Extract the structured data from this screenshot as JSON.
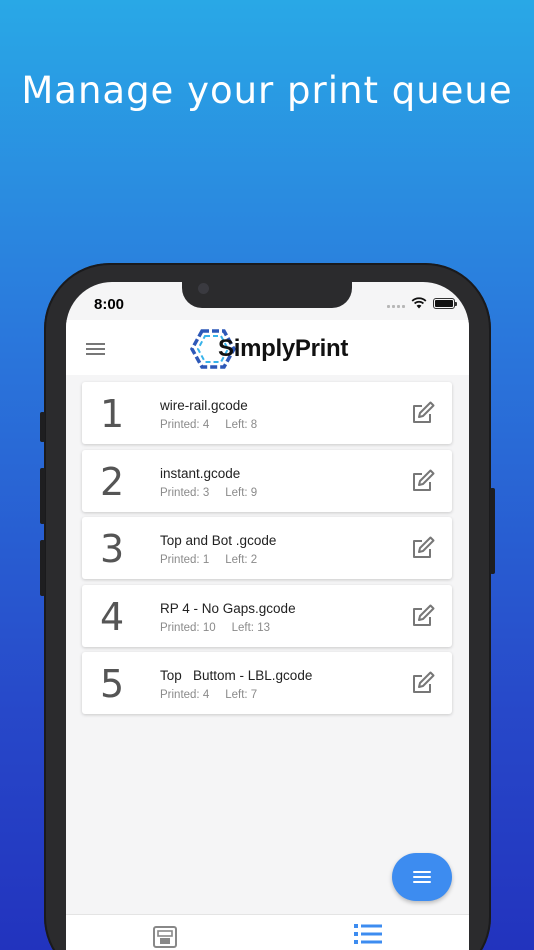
{
  "headline": "Manage your print queue",
  "status": {
    "time": "8:00"
  },
  "app": {
    "logo_text": "SimplyPrint"
  },
  "queue": [
    {
      "number": "1",
      "file": "wire-rail.gcode",
      "printed_label": "Printed: 4",
      "left_label": "Left: 8"
    },
    {
      "number": "2",
      "file": "instant.gcode",
      "printed_label": "Printed: 3",
      "left_label": "Left: 9"
    },
    {
      "number": "3",
      "file": "Top and Bot .gcode",
      "printed_label": "Printed: 1",
      "left_label": "Left: 2"
    },
    {
      "number": "4",
      "file": "RP 4 - No Gaps.gcode",
      "printed_label": "Printed: 10",
      "left_label": "Left: 13"
    },
    {
      "number": "5",
      "file": "Top   Buttom - LBL.gcode",
      "printed_label": "Printed: 4",
      "left_label": "Left: 7"
    }
  ],
  "icons": {
    "menu": "hamburger-icon",
    "edit": "edit-pencil-icon",
    "fab": "menu-lines-icon",
    "nav_printers": "printer-icon",
    "nav_queue": "list-icon",
    "wifi": "wifi-icon",
    "battery": "battery-icon",
    "signal": "signal-icon"
  },
  "colors": {
    "accent": "#3d8cf0",
    "background_top": "#29a8e6",
    "background_bottom": "#2233be"
  }
}
